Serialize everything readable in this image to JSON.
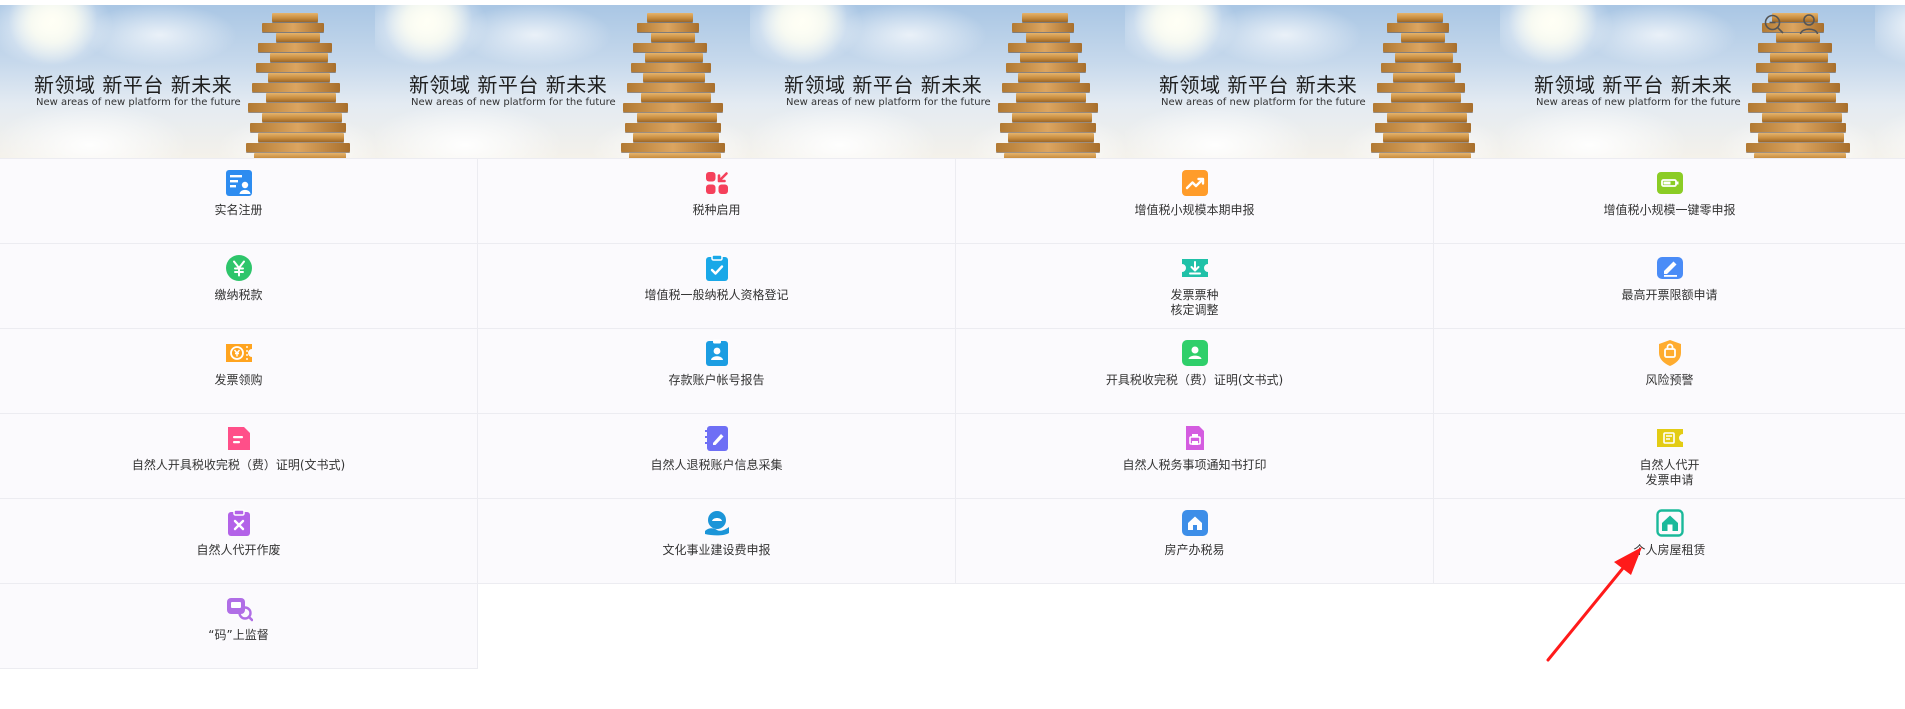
{
  "banner": {
    "slogan": "新领域 新平台 新未来",
    "slogan_en": "New areas of new platform for the future"
  },
  "header_icons": [
    "search-icon",
    "user-icon"
  ],
  "services": [
    {
      "label": "实名注册",
      "icon": "register-icon",
      "color": "#2d8cf0"
    },
    {
      "label": "税种启用",
      "icon": "tax-type-icon",
      "color": "#f5405b"
    },
    {
      "label": "增值税小规模本期申报",
      "icon": "trend-icon",
      "color": "#ff9c2a"
    },
    {
      "label": "增值税小规模一键零申报",
      "icon": "battery-icon",
      "color": "#8bcc25"
    },
    {
      "label": "缴纳税款",
      "icon": "yuan-icon",
      "color": "#2ec56b"
    },
    {
      "label": "增值税一般纳税人资格登记",
      "icon": "clipboard-check-icon",
      "color": "#19a8e8"
    },
    {
      "label": "发票票种\n核定调整",
      "icon": "ticket-download-icon",
      "color": "#1fc1a8"
    },
    {
      "label": "最高开票限额申请",
      "icon": "edit-icon",
      "color": "#4a8cf7"
    },
    {
      "label": "发票领购",
      "icon": "invoice-ticket-icon",
      "color": "#ffa41f"
    },
    {
      "label": "存款账户帐号报告",
      "icon": "id-card-icon",
      "color": "#1b9de2"
    },
    {
      "label": "开具税收完税（费）证明(文书式)",
      "icon": "certificate-icon",
      "color": "#2fcf6a"
    },
    {
      "label": "风险预警",
      "icon": "shield-alert-icon",
      "color": "#ffac2f"
    },
    {
      "label": "自然人开具税收完税（费）证明(文书式)",
      "icon": "document-icon",
      "color": "#ff4f89"
    },
    {
      "label": "自然人退税账户信息采集",
      "icon": "notebook-edit-icon",
      "color": "#6e6ff5"
    },
    {
      "label": "自然人税务事项通知书打印",
      "icon": "print-icon",
      "color": "#d45ce0"
    },
    {
      "label": "自然人代开\n发票申请",
      "icon": "invoice-apply-icon",
      "color": "#e3cc14"
    },
    {
      "label": "自然人代开作废",
      "icon": "clipboard-cancel-icon",
      "color": "#b362e8"
    },
    {
      "label": "文化事业建设费申报",
      "icon": "culture-hand-icon",
      "color": "#1b95d8"
    },
    {
      "label": "房产办税易",
      "icon": "house-icon",
      "color": "#3d8ee8"
    },
    {
      "label": "个人房屋租赁",
      "icon": "house-rent-icon",
      "color": "#1ab99a"
    },
    {
      "label": "“码”上监督",
      "icon": "qr-supervise-icon",
      "color": "#b06ee6"
    }
  ]
}
